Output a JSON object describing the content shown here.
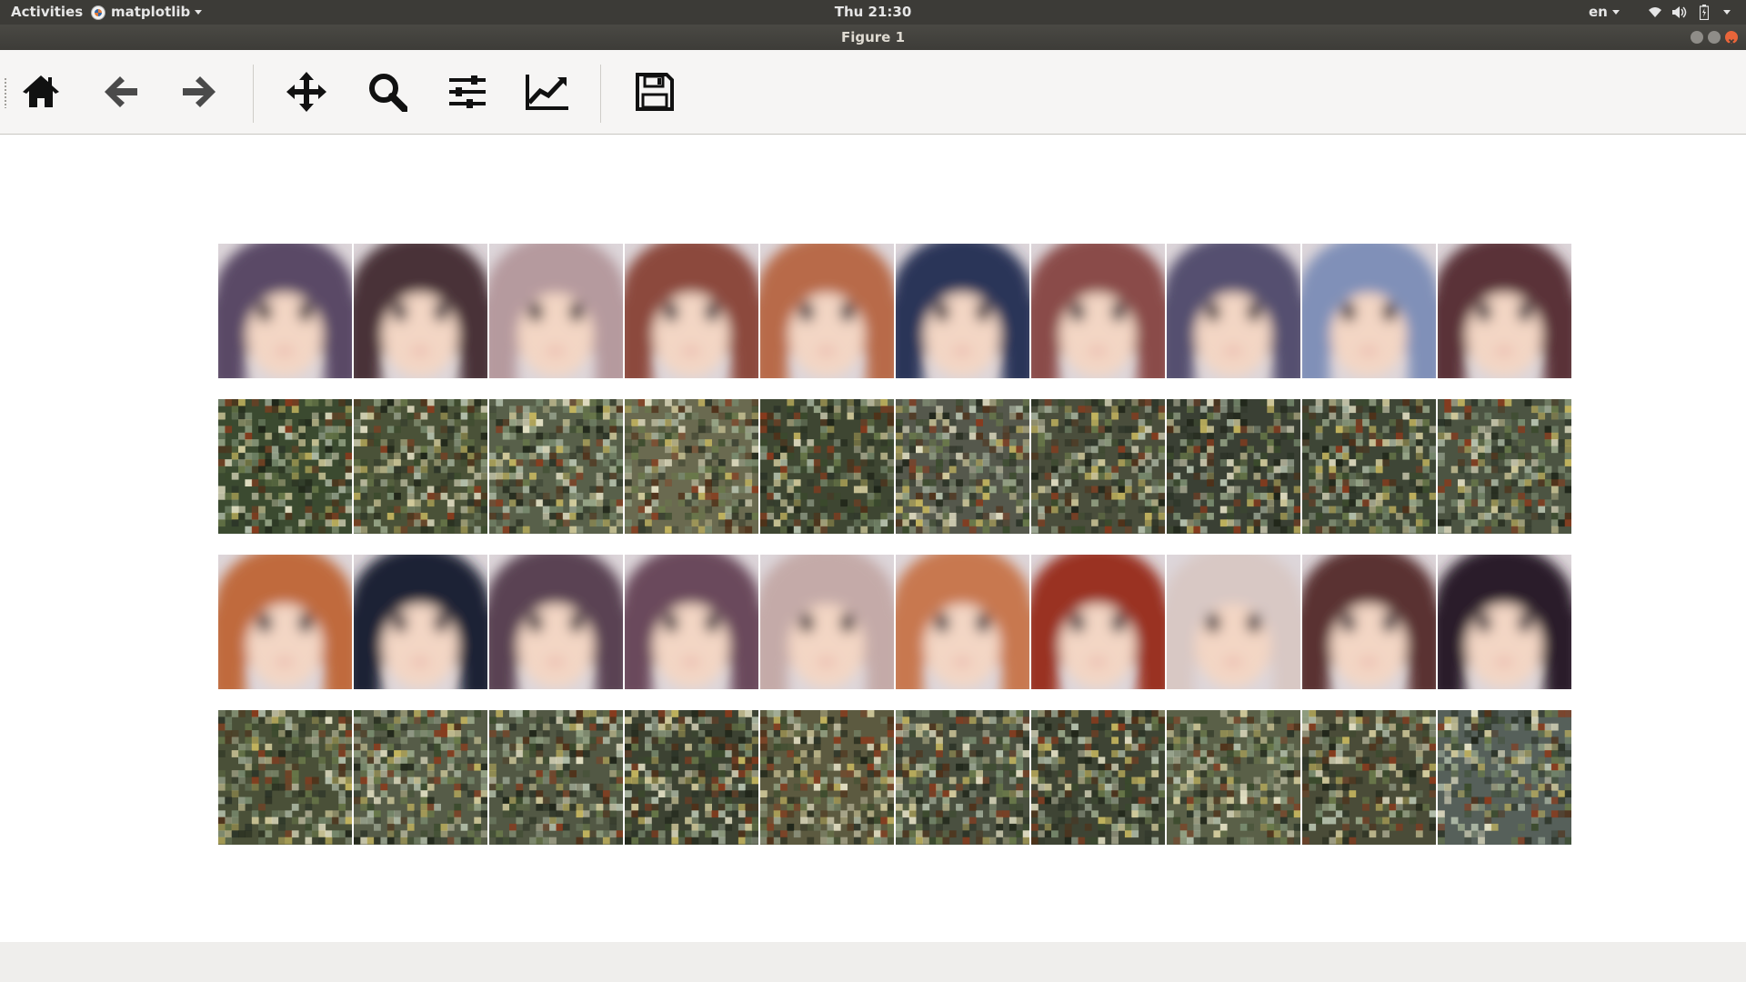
{
  "topbar": {
    "activities": "Activities",
    "app_name": "matplotlib",
    "clock": "Thu 21:30",
    "language": "en",
    "tray_icons": [
      "wifi-icon",
      "volume-icon",
      "battery-icon",
      "power-menu-icon"
    ]
  },
  "window": {
    "title": "Figure 1",
    "buttons": [
      "minimize",
      "maximize",
      "close"
    ]
  },
  "toolbar": {
    "buttons": [
      {
        "name": "home-icon",
        "tooltip": "Home"
      },
      {
        "name": "back-arrow-icon",
        "tooltip": "Back"
      },
      {
        "name": "forward-arrow-icon",
        "tooltip": "Forward"
      },
      {
        "name": "pan-move-icon",
        "tooltip": "Pan"
      },
      {
        "name": "zoom-magnifier-icon",
        "tooltip": "Zoom"
      },
      {
        "name": "configure-subplots-icon",
        "tooltip": "Subplots"
      },
      {
        "name": "edit-axes-icon",
        "tooltip": "Customize"
      },
      {
        "name": "save-floppy-icon",
        "tooltip": "Save"
      }
    ]
  },
  "figure": {
    "rows": [
      {
        "kind": "blurry-anime-face",
        "hair": [
          "#5a4a66",
          "#4a3038",
          "#b59a9e",
          "#8c4a3c",
          "#b86a4a",
          "#2c3458",
          "#8a4c48",
          "#555070",
          "#8090b8",
          "#5a3038"
        ]
      },
      {
        "kind": "noisy-generated",
        "hair": [
          "#3b4a30",
          "#4a5238",
          "#58604a",
          "#6a6a50",
          "#3e4632",
          "#55584c",
          "#4a4e3c",
          "#3a4034",
          "#3e4636",
          "#4c5442"
        ]
      },
      {
        "kind": "blurry-anime-face",
        "hair": [
          "#c06a3c",
          "#1c2236",
          "#5a4252",
          "#6a4a5c",
          "#c4aaa8",
          "#c87850",
          "#9a3020",
          "#d8c8c4",
          "#5a3032",
          "#2c1c2a"
        ]
      },
      {
        "kind": "noisy-generated",
        "hair": [
          "#4a5038",
          "#565c48",
          "#525844",
          "#3c4232",
          "#5c5a40",
          "#4a5040",
          "#3e4434",
          "#5a6048",
          "#4a4c38",
          "#56605a"
        ]
      }
    ]
  }
}
